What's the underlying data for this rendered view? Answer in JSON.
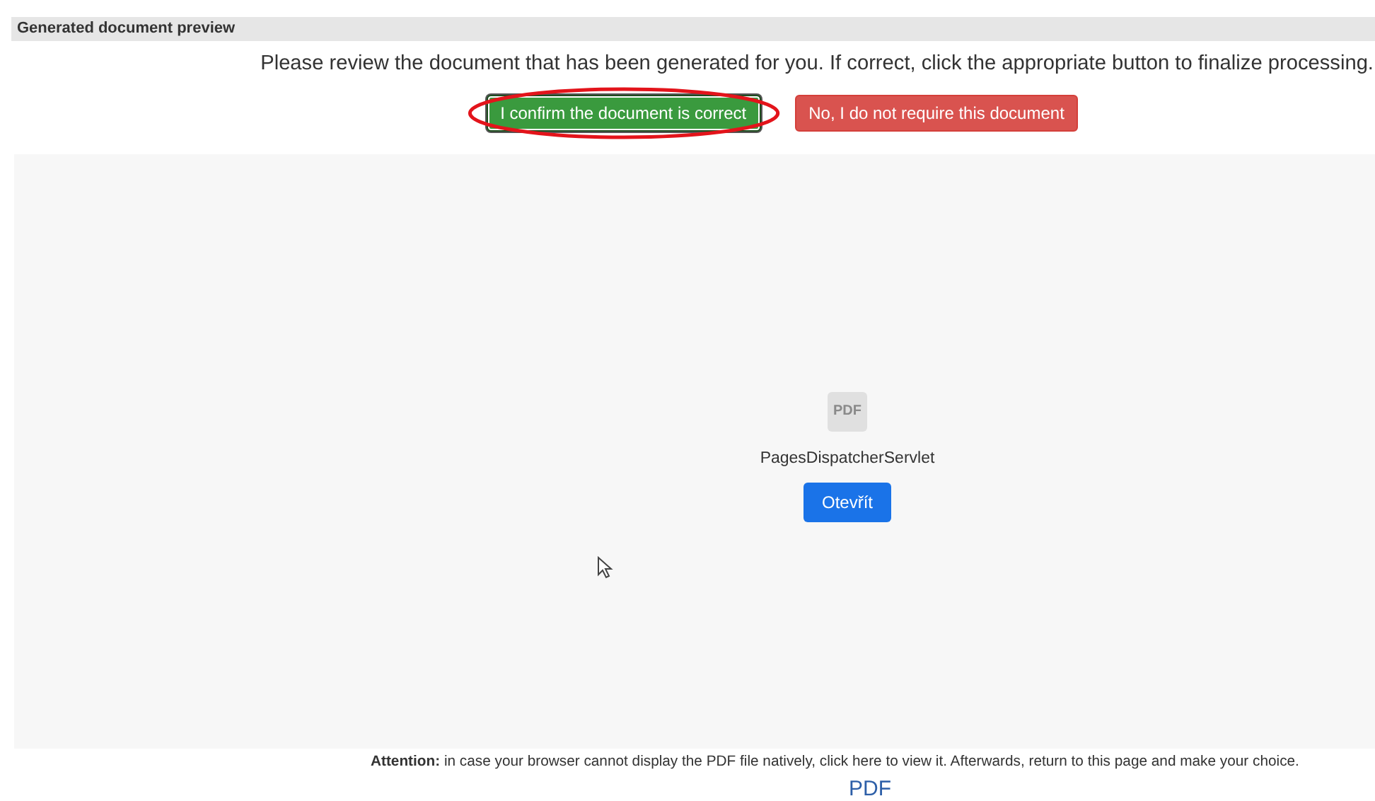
{
  "panel": {
    "title": "Generated document preview"
  },
  "instruction": "Please review the document that has been generated for you. If correct, click the appropriate button to finalize processing.",
  "buttons": [
    {
      "label": "I confirm the document is correct",
      "kind": "confirm",
      "circled": true
    },
    {
      "label": "No, I do not require this document",
      "kind": "decline",
      "circled": false
    }
  ],
  "viewer": {
    "icon_text": "PDF",
    "file_name": "PagesDispatcherServlet",
    "open_button": "Otevřít"
  },
  "notice": "**Attention:** in case your browser cannot display the PDF file natively, click here to view it. Afterwards, return to this page and make your choice.",
  "link": "PDF"
}
